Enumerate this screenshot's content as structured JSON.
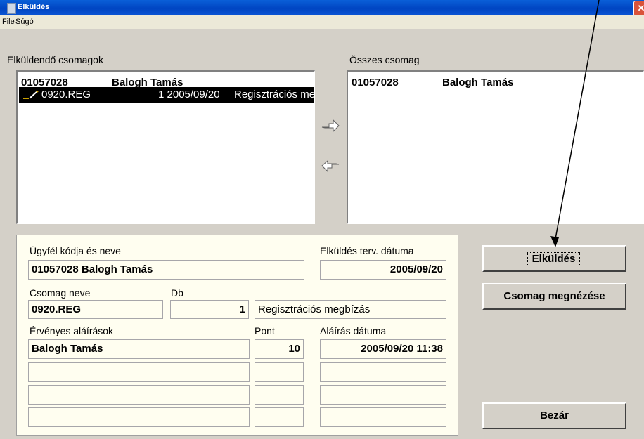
{
  "window": {
    "title": "Elküldés",
    "close_glyph": "✕"
  },
  "menu": {
    "file": "File",
    "help": "Súgó"
  },
  "left_list": {
    "label": "Elküldendő csomagok",
    "header_code": "01057028",
    "header_name": "Balogh Tamás",
    "row": {
      "name": "0920.REG",
      "count_date": "1 2005/09/20",
      "desc": "Regisztrációs megbízás"
    }
  },
  "right_list": {
    "label": "Összes csomag",
    "header_code": "01057028",
    "header_name": "Balogh Tamás"
  },
  "details": {
    "client_label": "Ügyfél kódja és neve",
    "client_value": "01057028  Balogh Tamás",
    "send_date_label": "Elküldés terv. dátuma",
    "send_date_value": "2005/09/20",
    "package_label": "Csomag neve",
    "package_value": "0920.REG",
    "db_label": "Db",
    "db_value": "1",
    "package_desc": "Regisztrációs megbízás",
    "signatures_label": "Érvényes aláírások",
    "points_label": "Pont",
    "sign_date_label": "Aláírás dátuma",
    "sig_rows": [
      {
        "name": "Balogh Tamás",
        "points": "10",
        "date": "2005/09/20 11:38"
      },
      {
        "name": "",
        "points": "",
        "date": ""
      },
      {
        "name": "",
        "points": "",
        "date": ""
      },
      {
        "name": "",
        "points": "",
        "date": ""
      }
    ]
  },
  "buttons": {
    "send": "Elküldés",
    "view": "Csomag megnézése",
    "close": "Bezár"
  },
  "icons": {
    "move_right": "arrow-right-icon",
    "move_left": "arrow-left-icon"
  }
}
